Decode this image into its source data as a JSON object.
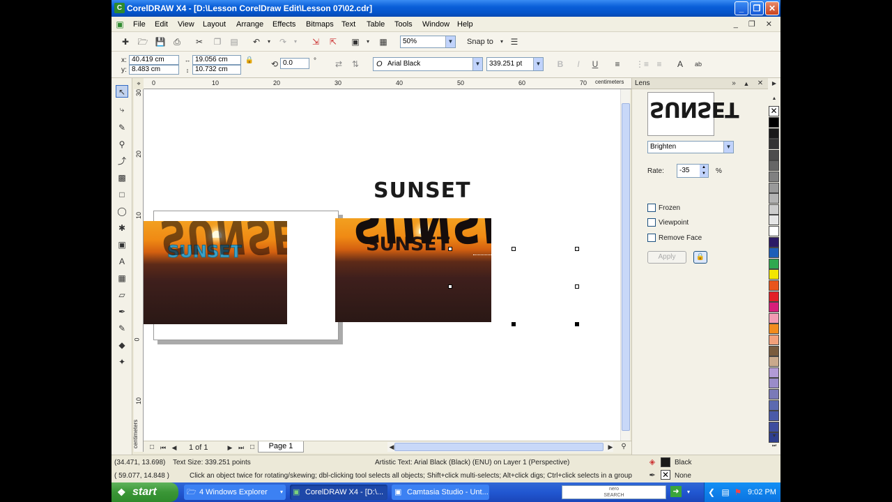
{
  "window": {
    "title": "CorelDRAW X4 - [D:\\Lesson CorelDraw Edit\\Lesson 07\\02.cdr]",
    "app_icon": "coreldraw-icon",
    "min_glyph": "_",
    "max_glyph": "❐",
    "close_glyph": "✕"
  },
  "menu": {
    "items": [
      "File",
      "Edit",
      "View",
      "Layout",
      "Arrange",
      "Effects",
      "Bitmaps",
      "Text",
      "Table",
      "Tools",
      "Window",
      "Help"
    ],
    "doc_controls": "_ ❐ ✕"
  },
  "toolbar1": {
    "zoom_value": "50%",
    "snap_label": "Snap to"
  },
  "propbar": {
    "x_label": "x:",
    "y_label": "y:",
    "x_value": "40.419 cm",
    "y_value": "8.483 cm",
    "w_value": "19.056 cm",
    "h_value": "10.732 cm",
    "angle_value": "0.0",
    "angle_unit": "°",
    "font_name": "Arial Black",
    "font_size": "339.251 pt"
  },
  "rulers": {
    "h_ticks": [
      "0",
      "10",
      "20",
      "30",
      "40",
      "50",
      "60",
      "70"
    ],
    "h_units": "centimeters",
    "v_ticks": [
      "30",
      "20",
      "10",
      "0",
      "10"
    ],
    "v_units": "centimeters"
  },
  "canvas": {
    "top_text": "SUNSET",
    "left_photo_text": "SUNSET",
    "left_photo_reflection": "SUNSET",
    "right_photo_text": "SUNSET",
    "right_photo_reflection": "SUNSET",
    "center_marker": "×"
  },
  "pagebar": {
    "page_count": "1 of 1",
    "page_tab": "Page 1"
  },
  "docker": {
    "title": "Lens",
    "preview_text": "SUNSET",
    "lens_type": "Brighten",
    "rate_label": "Rate:",
    "rate_value": "-35",
    "rate_unit": "%",
    "frozen_label": "Frozen",
    "viewpoint_label": "Viewpoint",
    "remove_face_label": "Remove Face",
    "apply_label": "Apply"
  },
  "palette": {
    "colors": [
      "#000000",
      "#1a1a1a",
      "#333333",
      "#4d4d4d",
      "#666666",
      "#808080",
      "#999999",
      "#b3b3b3",
      "#cccccc",
      "#e6e6e6",
      "#ffffff",
      "#2b1a66",
      "#1e5eb8",
      "#2fa84f",
      "#f2e600",
      "#e8551c",
      "#e21f26",
      "#d61f7a",
      "#f29bb3",
      "#f28c1c",
      "#f2a07a",
      "#7a5c3e",
      "#c9a98c",
      "#b29bd6",
      "#9a8cc9",
      "#7a7ab8",
      "#5c6ab0",
      "#4a5aa8",
      "#3e4e9e",
      "#2f3f8e"
    ]
  },
  "status": {
    "coords1": "(34.471, 13.698)",
    "text_size": "Text Size: 339.251 points",
    "object_info": "Artistic Text: Arial Black (Black) (ENU) on Layer 1  (Perspective)",
    "fill_name": "Black",
    "coords2": "( 59.077, 14.848 )",
    "hint": "Click an object twice for rotating/skewing; dbl-clicking tool selects all objects; Shift+click multi-selects; Alt+click digs; Ctrl+click selects in a group",
    "outline_name": "None"
  },
  "taskbar": {
    "start_label": "start",
    "items": [
      "4 Windows Explorer",
      "CorelDRAW X4 - [D:\\...",
      "Camtasia Studio - Unt..."
    ],
    "search_label": "nero\nSEARCH",
    "clock": "9:02 PM"
  }
}
